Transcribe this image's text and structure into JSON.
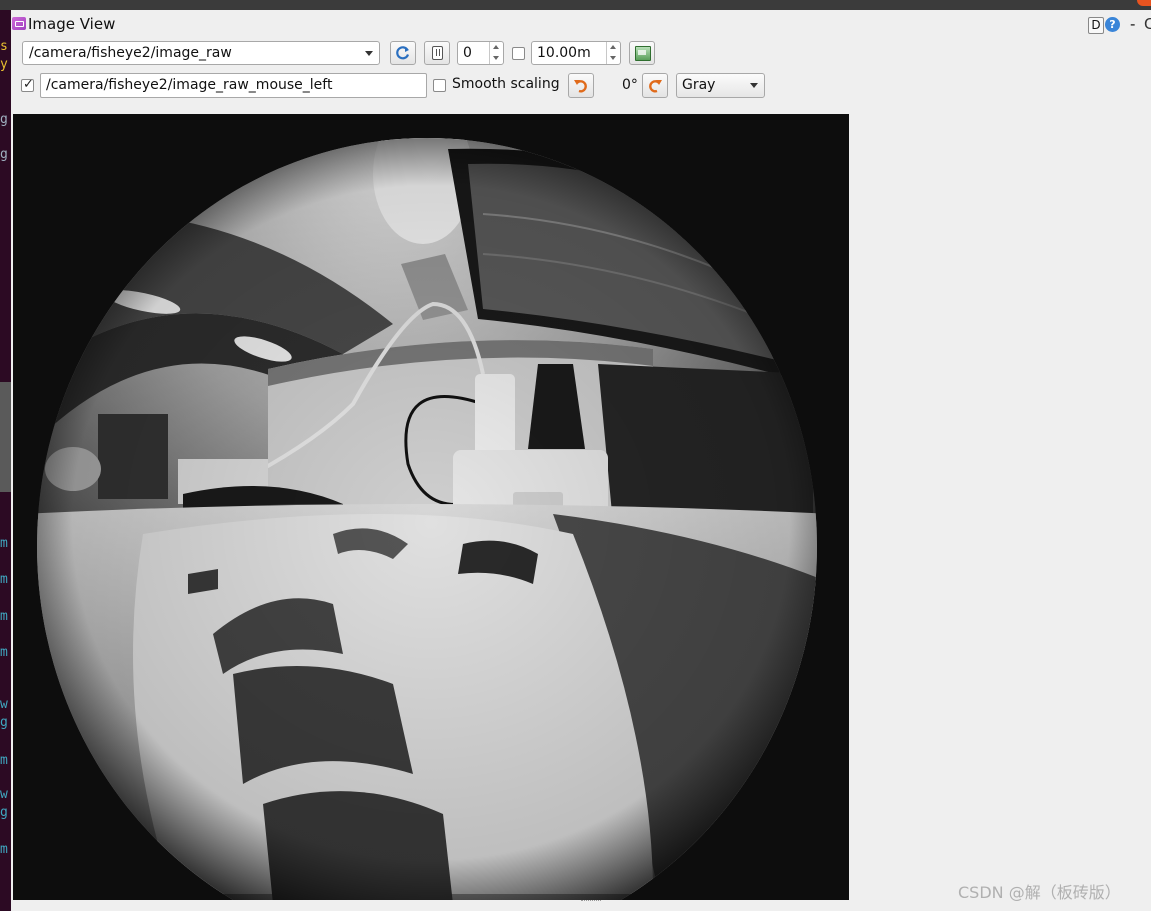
{
  "window": {
    "title": "Image View",
    "d_button": "D",
    "help_icon": "?",
    "minimize_icon": "-",
    "close_fragment": "C"
  },
  "terminal": {
    "fragments": [
      "s",
      "y",
      "g",
      "g",
      "m",
      "m",
      "m",
      "m",
      "w",
      "g",
      "m",
      "w",
      "g",
      "m"
    ]
  },
  "toolbar": {
    "topic": "/camera/fisheye2/image_raw",
    "queue_value": "0",
    "max_distance": "10.00m",
    "mouse_topic": "/camera/fisheye2/image_raw_mouse_left",
    "mouse_publish_checked": true,
    "smooth_scaling_label": "Smooth scaling",
    "rotation": "0°",
    "color_scheme": "Gray",
    "check_mark": "✓"
  },
  "icons": {
    "refresh": "refresh-icon",
    "pause": "pause-icon",
    "save": "save-image-icon",
    "rotate_left": "rotate-left-icon",
    "rotate_right": "rotate-right-icon"
  },
  "watermark": "CSDN @解（板砖版）",
  "colors": {
    "accent_orange": "#e06a1a",
    "refresh_blue": "#2a6fc0",
    "background": "#efefef"
  }
}
